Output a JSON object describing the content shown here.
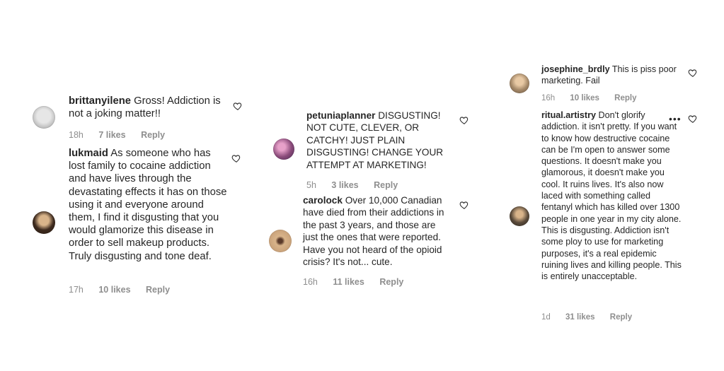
{
  "columns": [
    {
      "comments": [
        {
          "username": "brittanyilene",
          "text": "Gross! Addiction is not a joking matter!!",
          "time": "18h",
          "likes": "7 likes",
          "reply": "Reply",
          "avatar_color": "#c9c9c9"
        },
        {
          "username": "lukmaid",
          "text": "As someone who has lost family to cocaine addiction and have lives through the devastating effects it has on those using it and everyone around them, I find it disgusting that you would glamorize this disease in order to sell makeup products. Truly disgusting and tone deaf.",
          "time": "17h",
          "likes": "10 likes",
          "reply": "Reply",
          "avatar_color": "#7b5e3f"
        }
      ]
    },
    {
      "comments": [
        {
          "username": "petuniaplanner",
          "text": "DISGUSTING! NOT CUTE, CLEVER, OR CATCHY! JUST PLAIN DISGUSTING! CHANGE YOUR ATTEMPT AT MARKETING!",
          "time": "5h",
          "likes": "3 likes",
          "reply": "Reply",
          "avatar_color": "#8a4b7a"
        },
        {
          "username": "carolock",
          "text": "Over 10,000 Canadian have died from their addictions in the past 3 years, and those are just the ones that were reported. Have you not heard of the opioid crisis? It's not... cute.",
          "time": "16h",
          "likes": "11 likes",
          "reply": "Reply",
          "avatar_color": "#c9a27a"
        }
      ]
    },
    {
      "comments": [
        {
          "username": "josephine_brdly",
          "text": "This is piss poor marketing. Fail",
          "time": "16h",
          "likes": "10 likes",
          "reply": "Reply",
          "avatar_color": "#a68a6a"
        },
        {
          "username": "ritual.artistry",
          "text": "Don't glorify addiction. it isn't pretty. If you want to know how destructive cocaine can be I'm open to answer some questions. It doesn't make you glamorous, it doesn't make you cool. It ruins lives. It's also now laced with something called fentanyl which has killed over 1300 people in one year in my city alone. This is disgusting. Addiction isn't some ploy to use for marketing purposes, it's a real epidemic ruining lives and killing people. This is entirely unacceptable.",
          "time": "1d",
          "likes": "31 likes",
          "reply": "Reply",
          "more": "•••",
          "avatar_color": "#5a4a3a"
        }
      ]
    }
  ],
  "icons": {
    "like": "heart-outline-icon",
    "more": "more-options-icon"
  },
  "colors": {
    "text": "#262626",
    "meta": "#8e8e8e",
    "background": "#ffffff"
  }
}
